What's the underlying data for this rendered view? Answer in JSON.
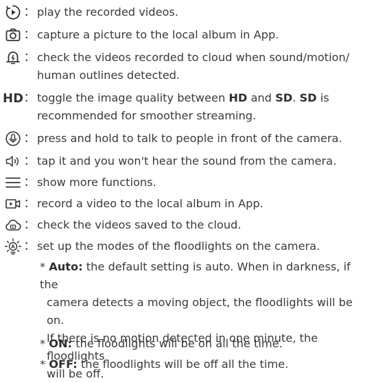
{
  "items": [
    {
      "icon": "play-circle-icon",
      "text": "play the recorded videos."
    },
    {
      "icon": "camera-icon",
      "text": "capture a picture to the local album in App."
    },
    {
      "icon": "cloud-alarm-icon",
      "line1": "check the videos recorded to cloud when sound/motion/",
      "line2": "human outlines detected."
    },
    {
      "icon_text": "HD",
      "pre": "toggle the image quality between ",
      "hd": "HD",
      "mid": " and ",
      "sd": "SD",
      "dot": ". ",
      "sd2": "SD",
      "post": " is",
      "line2": "recommended for smoother streaming."
    },
    {
      "icon": "microphone-icon",
      "text": "press and hold to talk to people in front of the camera."
    },
    {
      "icon": "speaker-icon",
      "text": "tap it and you won't hear the sound from the camera."
    },
    {
      "icon": "menu-icon",
      "text": "show more functions."
    },
    {
      "icon": "video-record-icon",
      "text": "record a video to the local album in App."
    },
    {
      "icon": "cloud-video-icon",
      "text": "check the videos saved to the cloud."
    },
    {
      "icon": "floodlight-auto-icon",
      "text": "set up the modes of the floodlights on the camera."
    }
  ],
  "notes": {
    "star": "* ",
    "auto_label": "Auto:",
    "auto_line1": " the default setting is auto. When in darkness, if the",
    "auto_line2": "camera detects a moving object, the floodlights will be on.",
    "auto_line3": "If there is no motion detected in one minute, the floodlights",
    "auto_line4": "will be off.",
    "on_label": "ON:",
    "on_text": " the floodlights will be on all the time.",
    "off_label": "OFF:",
    "off_text": " the floodlights will be off all the time."
  },
  "colon": "："
}
